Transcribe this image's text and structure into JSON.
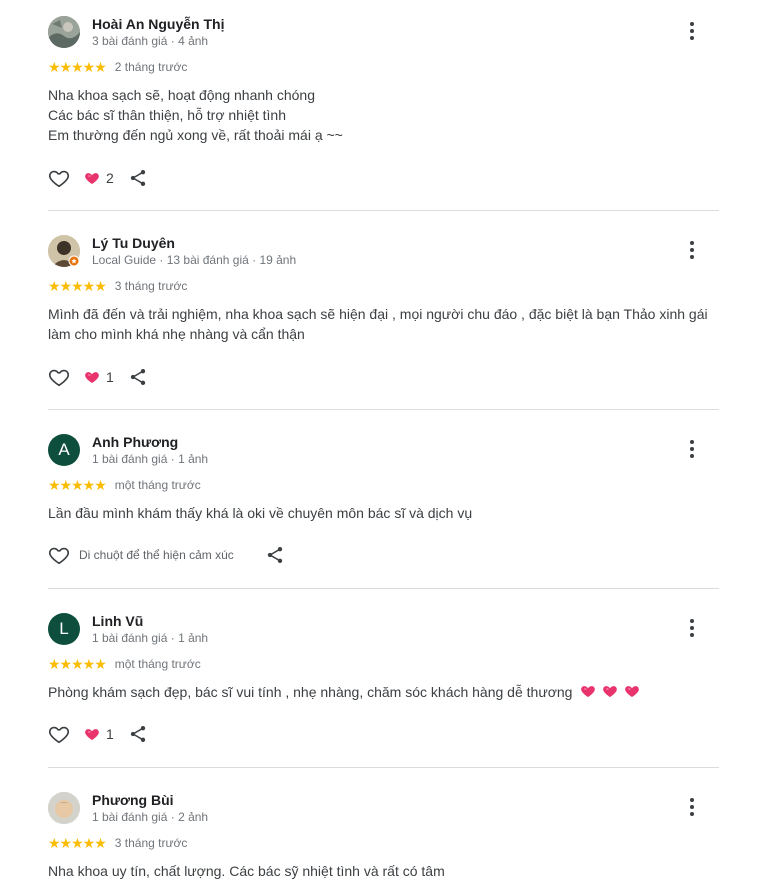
{
  "reviews": [
    {
      "name": "Hoài An Nguyễn Thị",
      "meta": "3 bài đánh giá · 4 ảnh",
      "stars": "★★★★★",
      "time": "2 tháng trước",
      "lines": [
        "Nha khoa sạch sẽ, hoạt động nhanh chóng",
        "Các bác sĩ thân thiện, hỗ trợ nhiệt tình",
        "Em thường đến ngủ xong về, rất thoải mái ạ ~~"
      ],
      "reactions": "2"
    },
    {
      "name": "Lý Tu Duyên",
      "meta": "Local Guide · 13 bài đánh giá · 19 ảnh",
      "stars": "★★★★★",
      "time": "3 tháng trước",
      "lines": [
        "Mình đã đến và trải nghiệm, nha khoa sạch sẽ hiện đại , mọi người chu đáo , đặc biệt là bạn Thảo xinh gái",
        "làm cho mình khá nhẹ nhàng và cẩn thận"
      ],
      "reactions": "1"
    },
    {
      "name": "Anh Phương",
      "avatar_letter": "A",
      "meta": "1 bài đánh giá · 1 ảnh",
      "stars": "★★★★★",
      "time": "một tháng trước",
      "lines": [
        "Lần đầu mình khám thấy khá là oki về chuyên môn bác sĩ và dịch vụ"
      ],
      "hover_hint": "Di chuột để thể hiện cảm xúc"
    },
    {
      "name": "Linh Vũ",
      "avatar_letter": "L",
      "meta": "1 bài đánh giá · 1 ảnh",
      "stars": "★★★★★",
      "time": "một tháng trước",
      "lines": [
        "Phòng khám sạch đẹp, bác sĩ vui tính , nhẹ nhàng, chăm sóc khách hàng dễ thương"
      ],
      "reactions": "1"
    },
    {
      "name": "Phương Bùi",
      "meta": "1 bài đánh giá · 2 ảnh",
      "stars": "★★★★★",
      "time": "3 tháng trước",
      "lines": [
        "Nha khoa uy tín, chất lượng. Các bác sỹ nhiệt tình và rất có tâm"
      ]
    }
  ],
  "colors": {
    "star": "#fbbc04",
    "heart": "#e8336d",
    "avatar_green": "#0d4f3c",
    "divider": "#dadce0"
  }
}
